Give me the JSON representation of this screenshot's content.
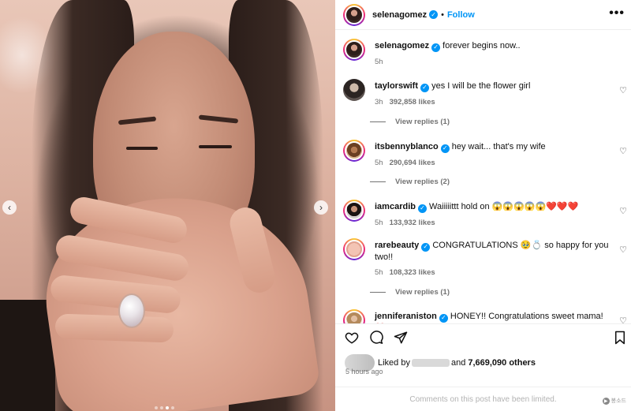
{
  "post": {
    "username": "selenagomez",
    "follow_label": "Follow",
    "caption": "forever begins now..",
    "caption_time": "5h"
  },
  "photo": {
    "slide_count": 4,
    "active_slide": 3
  },
  "comments": [
    {
      "username": "taylorswift",
      "text": "yes I will be the flower girl",
      "time": "3h",
      "likes": "392,858 likes",
      "replies": "View replies (1)"
    },
    {
      "username": "itsbennyblanco",
      "text": "hey wait... that's my wife",
      "time": "5h",
      "likes": "290,694 likes",
      "replies": "View replies (2)"
    },
    {
      "username": "iamcardib",
      "text": "Waiiiiittt hold on 😱😱😱😱😱❤️❤️❤️",
      "time": "5h",
      "likes": "133,932 likes",
      "replies": ""
    },
    {
      "username": "rarebeauty",
      "text": "CONGRATULATIONS 🥹💍 so happy for you two!!",
      "time": "5h",
      "likes": "108,323 likes",
      "replies": "View replies (1)"
    },
    {
      "username": "jenniferaniston",
      "text": "HONEY!! Congratulations sweet mama! ❤️",
      "time": "",
      "likes": "",
      "replies": ""
    }
  ],
  "likes": {
    "prefix": "Liked by",
    "suffix": "and",
    "others": "7,669,090 others",
    "time": "5 hours ago"
  },
  "footer": {
    "limited": "Comments on this post have been limited.",
    "watermark": "봉소드"
  },
  "colors": {
    "accent": "#0095f6",
    "muted": "#737373"
  }
}
